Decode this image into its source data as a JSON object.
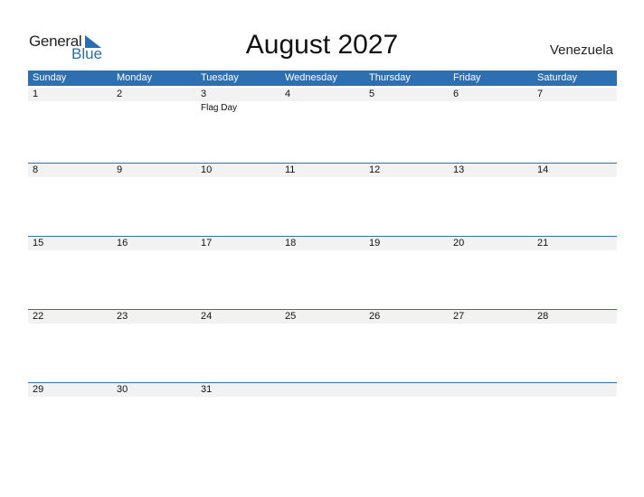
{
  "logo": {
    "line1": "General",
    "line2": "Blue"
  },
  "title": "August 2027",
  "country": "Venezuela",
  "colors": {
    "accent": "#2e6fb1",
    "date_strip": "#f2f2f2"
  },
  "weekdays": [
    "Sunday",
    "Monday",
    "Tuesday",
    "Wednesday",
    "Thursday",
    "Friday",
    "Saturday"
  ],
  "weeks": [
    {
      "days": [
        "1",
        "2",
        "3",
        "4",
        "5",
        "6",
        "7"
      ],
      "events": [
        "",
        "",
        "Flag Day",
        "",
        "",
        "",
        ""
      ]
    },
    {
      "days": [
        "8",
        "9",
        "10",
        "11",
        "12",
        "13",
        "14"
      ],
      "events": [
        "",
        "",
        "",
        "",
        "",
        "",
        ""
      ]
    },
    {
      "days": [
        "15",
        "16",
        "17",
        "18",
        "19",
        "20",
        "21"
      ],
      "events": [
        "",
        "",
        "",
        "",
        "",
        "",
        ""
      ]
    },
    {
      "days": [
        "22",
        "23",
        "24",
        "25",
        "26",
        "27",
        "28"
      ],
      "events": [
        "",
        "",
        "",
        "",
        "",
        "",
        ""
      ]
    },
    {
      "days": [
        "29",
        "30",
        "31",
        "",
        "",
        "",
        ""
      ],
      "events": [
        "",
        "",
        "",
        "",
        "",
        "",
        ""
      ]
    }
  ]
}
